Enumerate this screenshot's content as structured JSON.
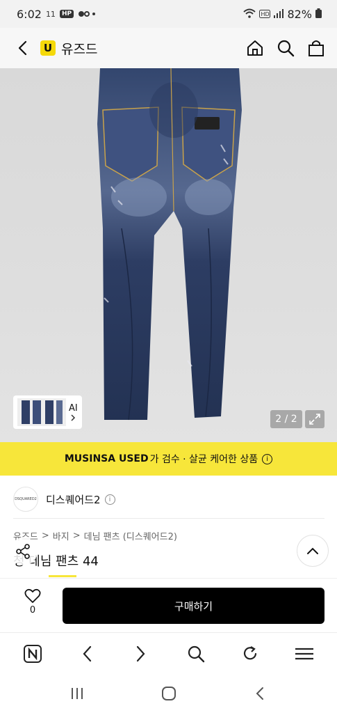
{
  "status_bar": {
    "time": "6:02",
    "indicator_1": "11",
    "hp_badge": "HP",
    "battery": "82%"
  },
  "header": {
    "brand_logo": "U",
    "brand_name": "유즈드",
    "icons": [
      "back-icon",
      "home-icon",
      "search-icon",
      "bag-icon"
    ]
  },
  "gallery": {
    "thumb_label": "AI",
    "page_counter": "2 / 2"
  },
  "banner": {
    "brand": "MUSINSA USED",
    "text": "가 검수 · 살균 케어한 상품",
    "info": "i"
  },
  "brand_row": {
    "avatar_text": "DSQUARED2",
    "name": "디스퀘어드2",
    "info": "i"
  },
  "breadcrumb": {
    "items": [
      "유즈드",
      "바지",
      "데님 팬츠 (디스퀘어드2)"
    ],
    "separator": ">"
  },
  "product": {
    "title": "청 데님 팬츠 44"
  },
  "buy_bar": {
    "like_count": "0",
    "buy_label": "구매하기"
  },
  "colors": {
    "accent_yellow": "#f7e63a",
    "buy_black": "#000000"
  }
}
